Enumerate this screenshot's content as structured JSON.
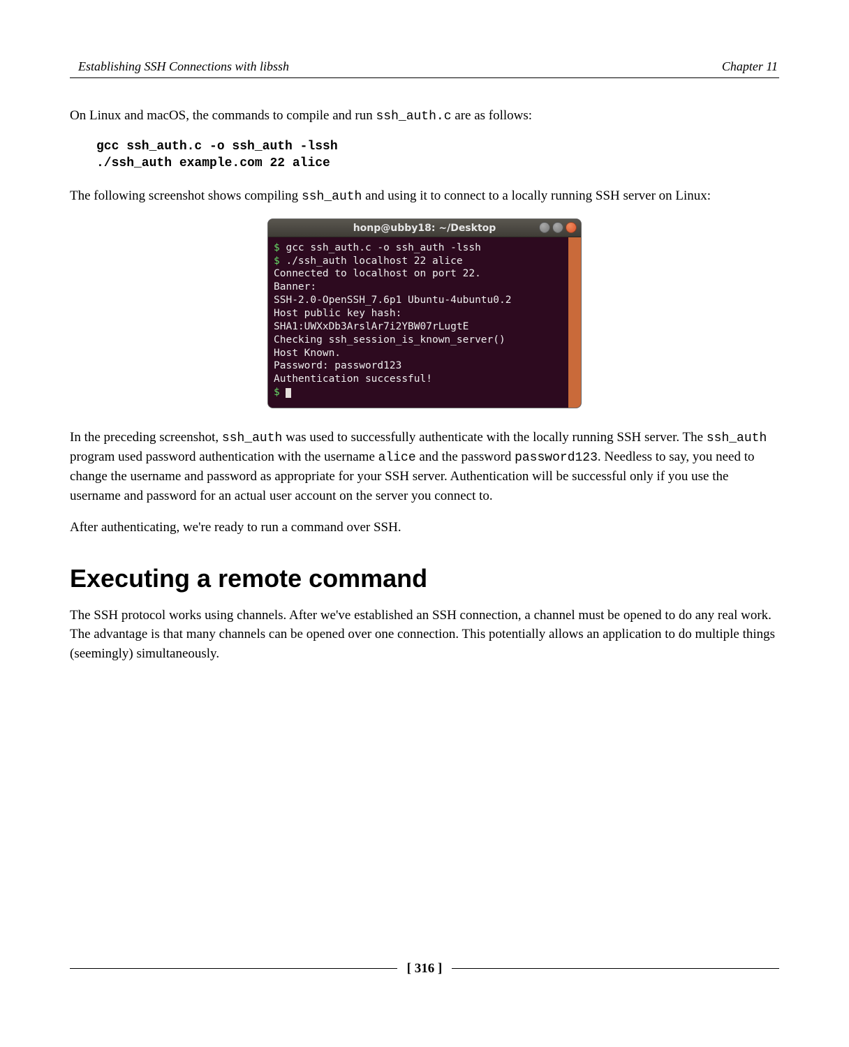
{
  "header": {
    "chapter_title": "Establishing SSH Connections with libssh",
    "chapter_label": "Chapter 11"
  },
  "body": {
    "para1_a": "On Linux and macOS, the commands to compile and run ",
    "para1_code": "ssh_auth.c",
    "para1_b": " are as follows:",
    "code_block": "gcc ssh_auth.c -o ssh_auth -lssh\n./ssh_auth example.com 22 alice",
    "para2_a": "The following screenshot shows compiling ",
    "para2_code": "ssh_auth",
    "para2_b": " and using it to connect to a locally running SSH server on Linux:",
    "terminal": {
      "title": "honp@ubby18: ~/Desktop",
      "line1_prompt": "$ ",
      "line1_cmd": "gcc ssh_auth.c -o ssh_auth -lssh",
      "line2_prompt": "$ ",
      "line2_cmd": "./ssh_auth localhost 22 alice",
      "line3": "Connected to localhost on port 22.",
      "line4": "Banner:",
      "line5": "SSH-2.0-OpenSSH_7.6p1 Ubuntu-4ubuntu0.2",
      "line6": "Host public key hash:",
      "line7": "SHA1:UWXxDb3ArslAr7i2YBW07rLugtE",
      "line8": "Checking ssh_session_is_known_server()",
      "line9": "Host Known.",
      "line10": "Password: password123",
      "line11": "Authentication successful!",
      "line12_prompt": "$ "
    },
    "para3_a": "In the preceding screenshot, ",
    "para3_code1": "ssh_auth",
    "para3_b": " was used to successfully authenticate with the locally running SSH server. The ",
    "para3_code2": "ssh_auth",
    "para3_c": " program used password authentication with the username ",
    "para3_code3": "alice",
    "para3_d": " and the password ",
    "para3_code4": "password123",
    "para3_e": ". Needless to say, you need to change the username and password as appropriate for your SSH server. Authentication will be successful only if you use the username and password for an actual user account on the server you connect to.",
    "para4": "After authenticating, we're ready to run a command over SSH.",
    "heading": "Executing a remote command",
    "para5": "The SSH protocol works using channels. After we've established an SSH connection, a channel must be opened to do any real work. The advantage is that many channels can be opened over one connection. This potentially allows an application to do multiple things (seemingly) simultaneously."
  },
  "footer": {
    "page_number": "[ 316 ]"
  }
}
